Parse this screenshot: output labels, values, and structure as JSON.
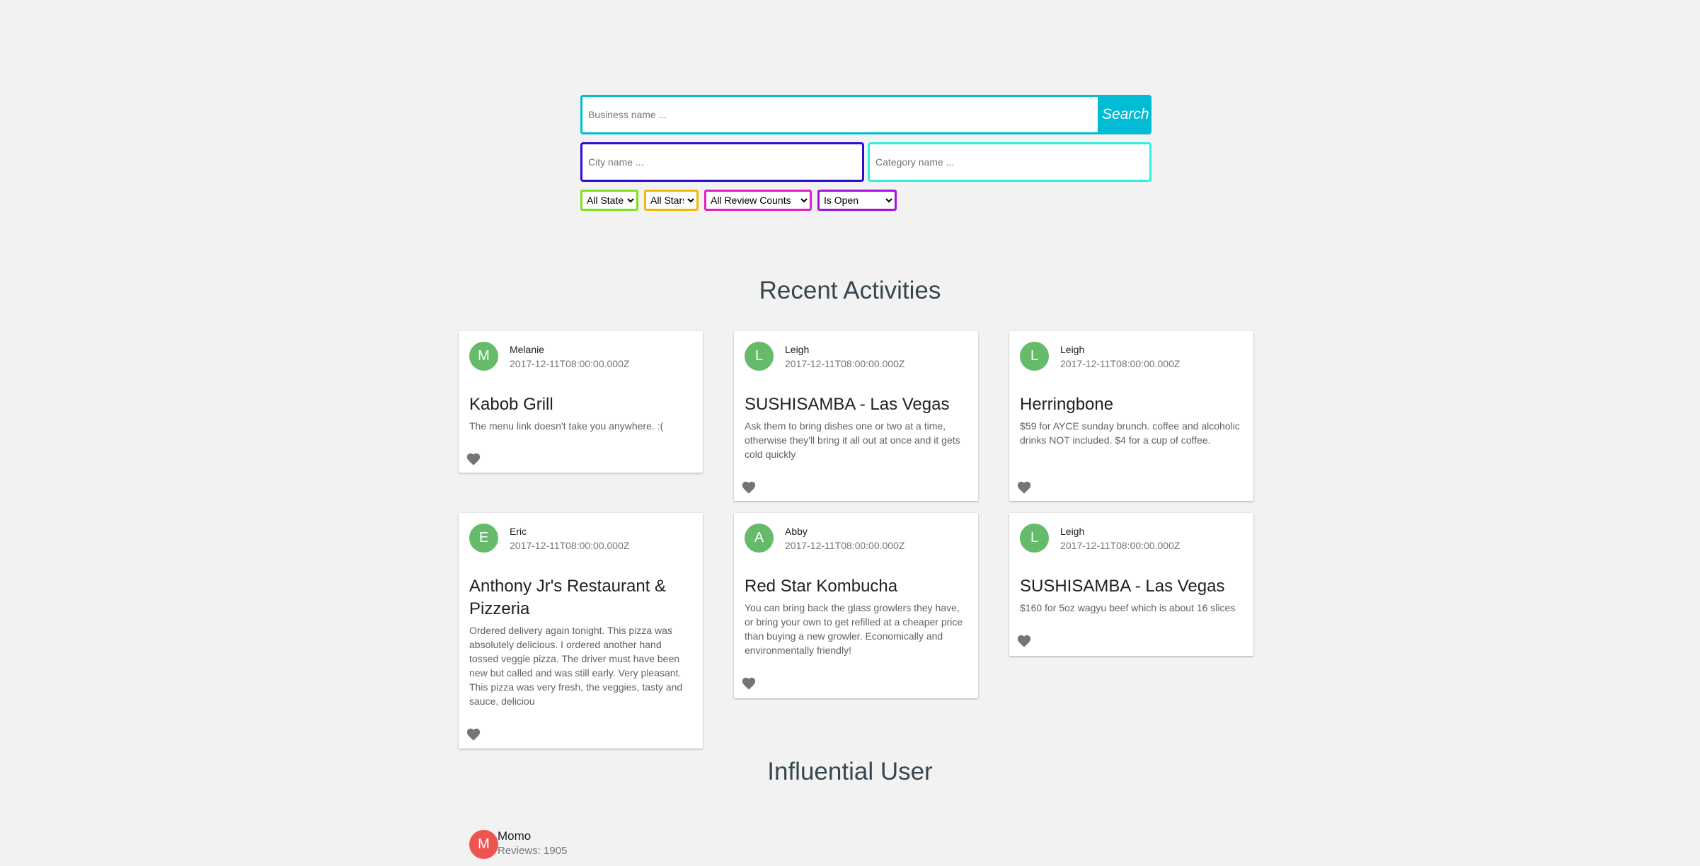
{
  "search": {
    "business_placeholder": "Business name ...",
    "search_label": "Search",
    "city_placeholder": "City name ...",
    "category_placeholder": "Category name ..."
  },
  "filters": {
    "state": "All States",
    "stars": "All Stars",
    "review_counts": "All Review Counts",
    "is_open": "Is Open"
  },
  "recent": {
    "title": "Recent Activities",
    "cards": [
      {
        "initial": "M",
        "user": "Melanie",
        "date": "2017-12-11T08:00:00.000Z",
        "business": "Kabob Grill",
        "text": "The menu link doesn't take you anywhere. :("
      },
      {
        "initial": "L",
        "user": "Leigh",
        "date": "2017-12-11T08:00:00.000Z",
        "business": "SUSHISAMBA - Las Vegas",
        "text": "Ask them to bring dishes one or two at a time, otherwise they'll bring it all out at once and it gets cold quickly"
      },
      {
        "initial": "L",
        "user": "Leigh",
        "date": "2017-12-11T08:00:00.000Z",
        "business": "Herringbone",
        "text": "$59 for AYCE sunday brunch. coffee and alcoholic drinks NOT included. $4 for a cup of coffee."
      },
      {
        "initial": "E",
        "user": "Eric",
        "date": "2017-12-11T08:00:00.000Z",
        "business": "Anthony Jr's Restaurant & Pizzeria",
        "text": "Ordered delivery again tonight. This pizza was absolutely delicious. I ordered another hand tossed veggie pizza. The driver must have been new but called and was still early. Very pleasant. This pizza was very fresh, the veggies, tasty and sauce, deliciou"
      },
      {
        "initial": "A",
        "user": "Abby",
        "date": "2017-12-11T08:00:00.000Z",
        "business": "Red Star Kombucha",
        "text": "You can bring back the glass growlers they have, or bring your own to get refilled at a cheaper price than buying a new growler. Economically and environmentally friendly!"
      },
      {
        "initial": "L",
        "user": "Leigh",
        "date": "2017-12-11T08:00:00.000Z",
        "business": "SUSHISAMBA - Las Vegas",
        "text": "$160 for 5oz wagyu beef which is about 16 slices"
      }
    ]
  },
  "influential": {
    "title": "Influential User",
    "user": {
      "initial": "M",
      "name": "Momo",
      "reviews_label": "Reviews: 1905"
    }
  },
  "colors": {
    "search_accent": "#00bcd4",
    "avatar_green": "#66bb6a",
    "avatar_red": "#ef5350"
  }
}
